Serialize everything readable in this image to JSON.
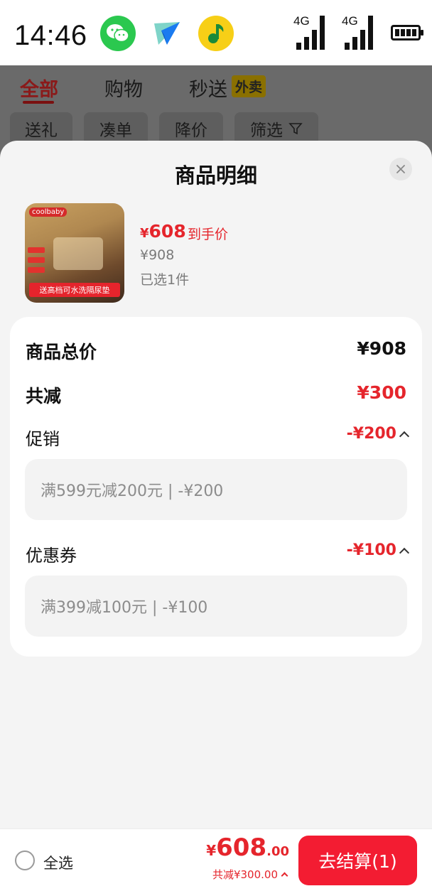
{
  "status_bar": {
    "time": "14:46",
    "network_1": "4G",
    "network_2": "4G",
    "app_icons": [
      "wechat-icon",
      "paper-plane-icon",
      "music-icon"
    ]
  },
  "background_page": {
    "tabs": [
      {
        "label": "全部",
        "active": true
      },
      {
        "label": "购物",
        "active": false
      },
      {
        "label": "秒送",
        "active": false
      }
    ],
    "takeout_badge": "外卖",
    "filters": [
      "送礼",
      "凑单",
      "降价",
      "筛选"
    ]
  },
  "sheet": {
    "title": "商品明细",
    "product": {
      "image_brand": "coolbaby",
      "image_banner": "送高档可水洗隔尿垫",
      "price_currency": "¥",
      "price_amount": "608",
      "price_tag": "到手价",
      "original_price": "¥908",
      "selected_count": "已选1件"
    },
    "summary": {
      "total_label": "商品总价",
      "total_value": "¥908",
      "discount_label": "共减",
      "discount_value": "¥300",
      "promotion_label": "促销",
      "promotion_value": "-¥200",
      "promotion_detail": "满599元减200元 | -¥200",
      "coupon_label": "优惠券",
      "coupon_value": "-¥100",
      "coupon_detail": "满399减100元 | -¥100"
    }
  },
  "bottom_bar": {
    "select_all_label": "全选",
    "total_currency": "¥",
    "total_integer": "608",
    "total_decimal": ".00",
    "saved_text": "共减¥300.00",
    "checkout_label": "去结算(1)"
  },
  "colors": {
    "accent_red": "#e5252c",
    "checkout_button": "#f31c32"
  }
}
